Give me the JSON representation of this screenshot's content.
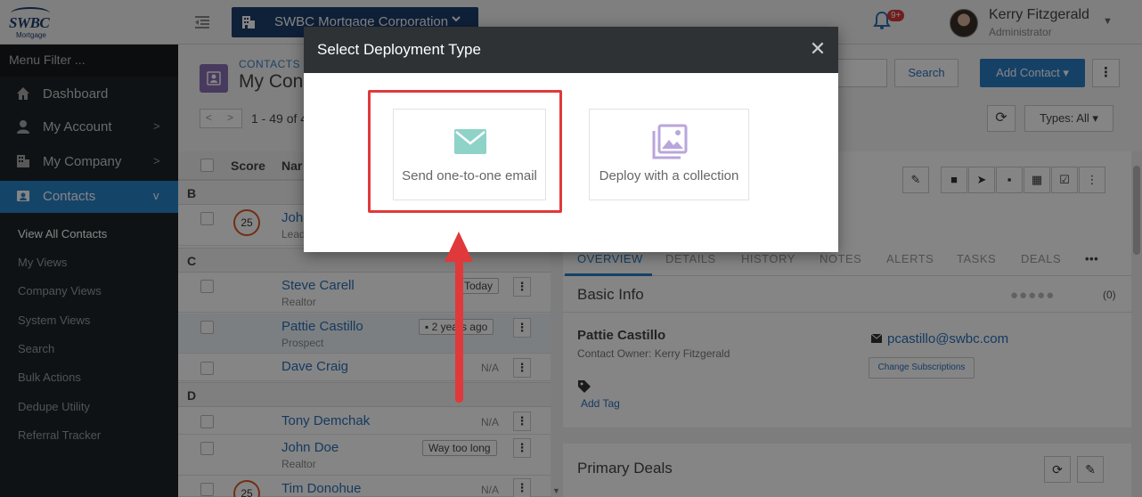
{
  "header": {
    "company": "SWBC Mortgage Corporation",
    "notification_count": "9+",
    "user_name": "Kerry Fitzgerald",
    "user_role": "Administrator",
    "logo_text": "SWBC",
    "logo_sub": "Mortgage"
  },
  "sidebar": {
    "filter": "Menu Filter ...",
    "items": [
      {
        "label": "Dashboard"
      },
      {
        "label": "My Account"
      },
      {
        "label": "My Company"
      },
      {
        "label": "Contacts"
      }
    ],
    "subitems": [
      "View All Contacts",
      "My Views",
      "Company Views",
      "System Views",
      "Search",
      "Bulk Actions",
      "Dedupe Utility",
      "Referral Tracker"
    ]
  },
  "main": {
    "breadcrumb": "CONTACTS",
    "title": "My Con",
    "pager": "1 - 49 of 4",
    "search_button": "Search",
    "add_contact": "Add Contact",
    "types_filter": "Types: All",
    "columns": [
      "Score",
      "Nar"
    ],
    "groups": [
      "B",
      "C",
      "D"
    ],
    "rows": [
      {
        "name": "John",
        "sub": "Lead",
        "score": "25"
      },
      {
        "name": "Steve Carell",
        "sub": "Realtor",
        "status": "Today"
      },
      {
        "name": "Pattie Castillo",
        "sub": "Prospect",
        "status": "2 years ago"
      },
      {
        "name": "Dave Craig",
        "status": "N/A"
      },
      {
        "name": "Tony Demchak",
        "status": "N/A"
      },
      {
        "name": "John Doe",
        "sub": "Realtor",
        "status": "Way too long"
      },
      {
        "name": "Tim Donohue",
        "score": "25",
        "status": "N/A"
      }
    ]
  },
  "detail": {
    "tabs": [
      "OVERVIEW",
      "DETAILS",
      "HISTORY",
      "NOTES",
      "ALERTS",
      "TASKS",
      "DEALS"
    ],
    "basic_info": "Basic Info",
    "rating_count": "(0)",
    "contact_name": "Pattie Castillo",
    "owner": "Contact Owner: Kerry Fitzgerald",
    "add_tag": "Add Tag",
    "email": "pcastillo@swbc.com",
    "change_subs": "Change Subscriptions",
    "primary_deals": "Primary Deals"
  },
  "modal": {
    "title": "Select Deployment Type",
    "options": [
      {
        "label": "Send one-to-one email",
        "icon": "envelope-icon",
        "color": "#8fd3c8"
      },
      {
        "label": "Deploy with a collection",
        "icon": "image-collection-icon",
        "color": "#b9a6dc"
      }
    ]
  },
  "colors": {
    "accent": "#2b7dc6",
    "annotation": "#e0393b",
    "company_bar": "#1d3e6e"
  }
}
